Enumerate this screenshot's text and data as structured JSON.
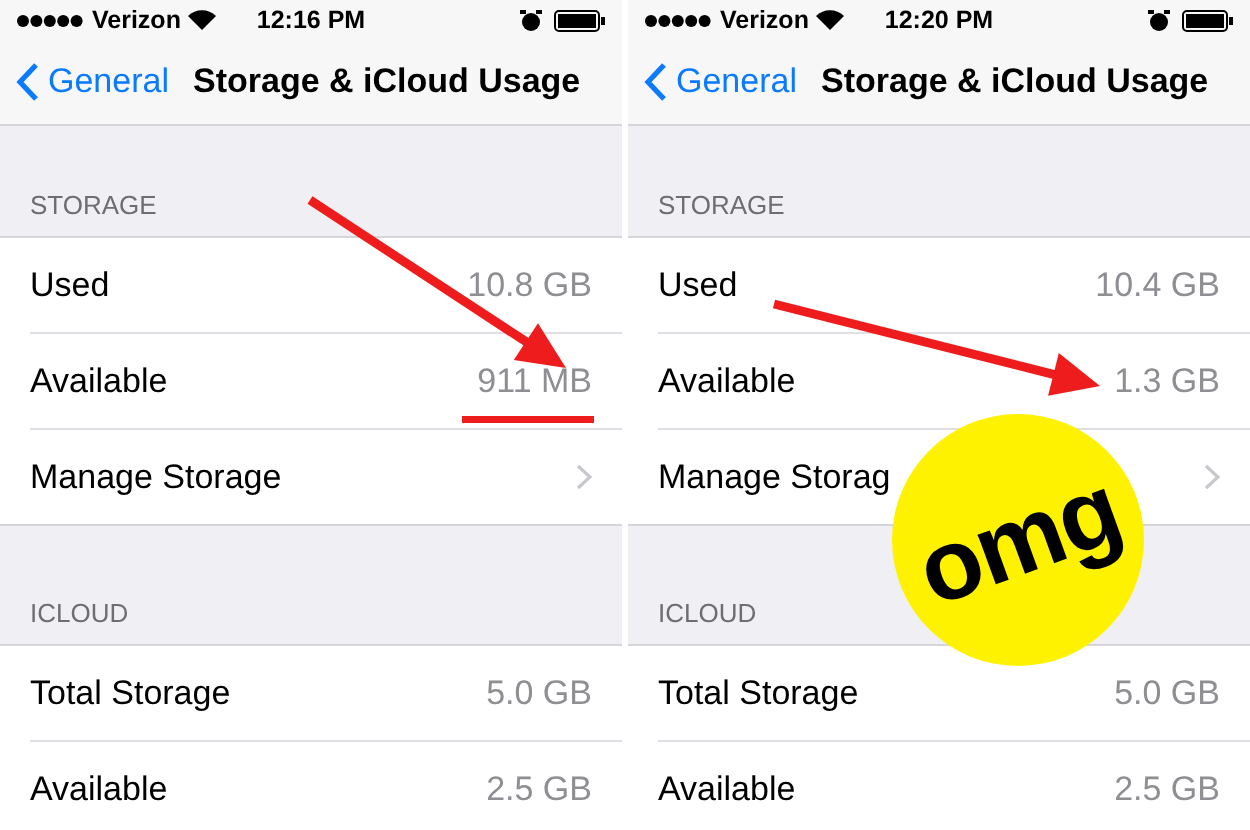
{
  "screens": [
    {
      "status_bar": {
        "carrier": "Verizon",
        "time": "12:16 PM"
      },
      "nav": {
        "back": "General",
        "title": "Storage & iCloud Usage"
      },
      "sections": [
        {
          "header": "STORAGE",
          "rows": [
            {
              "kind": "value",
              "label": "Used",
              "value": "10.8 GB"
            },
            {
              "kind": "value",
              "label": "Available",
              "value": "911 MB"
            },
            {
              "kind": "link",
              "label": "Manage Storage"
            }
          ]
        },
        {
          "header": "ICLOUD",
          "rows": [
            {
              "kind": "value",
              "label": "Total Storage",
              "value": "5.0 GB"
            },
            {
              "kind": "value",
              "label": "Available",
              "value": "2.5 GB"
            }
          ]
        }
      ],
      "annotations": [
        {
          "kind": "steep-arrow"
        },
        {
          "kind": "underline"
        }
      ]
    },
    {
      "status_bar": {
        "carrier": "Verizon",
        "time": "12:20 PM"
      },
      "nav": {
        "back": "General",
        "title": "Storage & iCloud Usage"
      },
      "sections": [
        {
          "header": "STORAGE",
          "rows": [
            {
              "kind": "value",
              "label": "Used",
              "value": "10.4 GB"
            },
            {
              "kind": "value",
              "label": "Available",
              "value": "1.3 GB"
            },
            {
              "kind": "link",
              "label": "Manage Storag"
            }
          ]
        },
        {
          "header": "ICLOUD",
          "rows": [
            {
              "kind": "value",
              "label": "Total Storage",
              "value": "5.0 GB"
            },
            {
              "kind": "value",
              "label": "Available",
              "value": "2.5 GB"
            }
          ]
        }
      ],
      "annotations": [
        {
          "kind": "shallow-arrow"
        }
      ],
      "sticker": {
        "text": "omg"
      }
    }
  ]
}
